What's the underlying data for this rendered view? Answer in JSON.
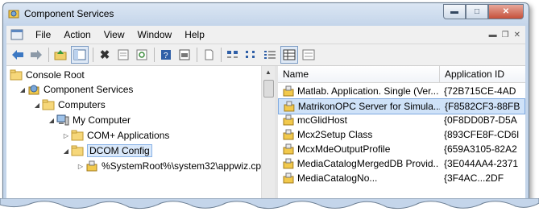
{
  "window": {
    "title": "Component Services"
  },
  "menu": {
    "items": [
      "File",
      "Action",
      "View",
      "Window",
      "Help"
    ]
  },
  "toolbar": {
    "icons": [
      "back-arrow-icon",
      "forward-arrow-icon",
      "up-folder-icon",
      "show-tree-icon",
      "delete-icon",
      "properties-icon",
      "refresh-icon",
      "help-icon",
      "view-icon",
      "export-icon",
      "large-icons-icon",
      "small-icons-icon",
      "list-view-icon",
      "details-view-icon",
      "other-view-icon"
    ]
  },
  "tree": {
    "items": [
      {
        "label": "Console Root"
      },
      {
        "label": "Component Services"
      },
      {
        "label": "Computers"
      },
      {
        "label": "My Computer"
      },
      {
        "label": "COM+ Applications"
      },
      {
        "label": "DCOM Config"
      },
      {
        "label": "%SystemRoot%\\system32\\appwiz.cp"
      }
    ]
  },
  "list": {
    "headers": {
      "name": "Name",
      "id": "Application ID"
    },
    "rows": [
      {
        "name": "Matlab. Application. Single (Ver...",
        "id": "{72B715CE-4AD"
      },
      {
        "name": "MatrikonOPC Server for Simula...",
        "id": "{F8582CF3-88FB"
      },
      {
        "name": "mcGlidHost",
        "id": "{0F8DD0B7-D5A"
      },
      {
        "name": "Mcx2Setup Class",
        "id": "{893CFE8F-CD6I"
      },
      {
        "name": "McxMdeOutputProfile",
        "id": "{659A3105-82A2"
      },
      {
        "name": "MediaCatalogMergedDB Provid...",
        "id": "{3E044AA4-2371"
      },
      {
        "name": "MediaCatalogNo...",
        "id": "{3F4AC...2DF"
      }
    ]
  }
}
